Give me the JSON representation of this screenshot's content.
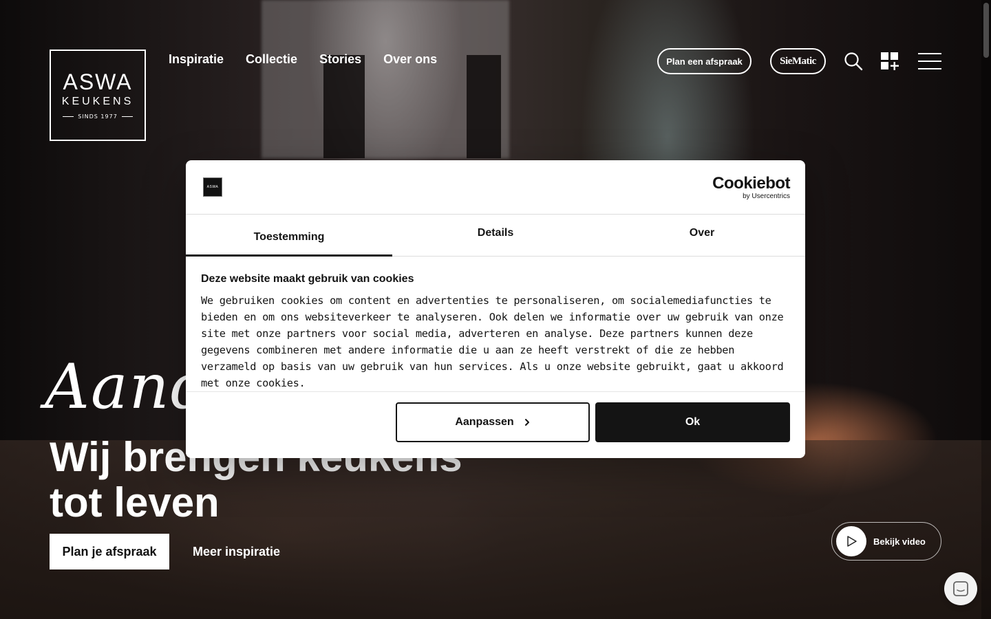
{
  "logo": {
    "line1": "ASWA",
    "line2": "KEUKENS",
    "line3": "SINDS 1977"
  },
  "nav": {
    "items": [
      {
        "label": "Inspiratie"
      },
      {
        "label": "Collectie"
      },
      {
        "label": "Stories"
      },
      {
        "label": "Over ons"
      }
    ]
  },
  "header": {
    "appointment_label": "Plan een afspraak",
    "partner_label": "SieMatic",
    "search_icon": "search-icon",
    "configurator_icon": "grid-plus-icon",
    "menu_icon": "hamburger-menu-icon"
  },
  "hero": {
    "script_word": "Aand",
    "headline_line1": "Wij brengen keukens",
    "headline_line2": "tot leven",
    "cta_primary": "Plan je afspraak",
    "cta_secondary": "Meer inspiratie",
    "video_label": "Bekijk video"
  },
  "cookie_dialog": {
    "brand_logo_text": "ASWA",
    "provider_name": "Cookiebot",
    "provider_sub": "by Usercentrics",
    "tabs": [
      {
        "label": "Toestemming",
        "active": true
      },
      {
        "label": "Details",
        "active": false
      },
      {
        "label": "Over",
        "active": false
      }
    ],
    "title": "Deze website maakt gebruik van cookies",
    "text": "We gebruiken cookies om content en advertenties te personaliseren, om socialemediafuncties te bieden en om ons websiteverkeer te analyseren. Ook delen we informatie over uw gebruik van onze site met onze partners voor social media, adverteren en analyse. Deze partners kunnen deze gegevens combineren met andere informatie die u aan ze heeft verstrekt of die ze hebben verzameld op basis van uw gebruik van hun services. Als u onze website gebruikt, gaat u akkoord met onze cookies.",
    "customize_label": "Aanpassen",
    "ok_label": "Ok"
  },
  "colors": {
    "dialog_text": "#141414",
    "dialog_bg": "#ffffff",
    "accent_dark": "#141414"
  }
}
